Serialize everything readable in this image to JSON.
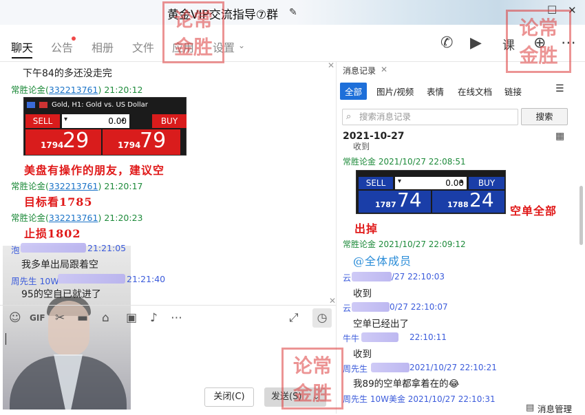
{
  "window": {
    "title": "黄金VIP交流指导⑦群"
  },
  "nav": {
    "tabs": [
      "聊天",
      "公告",
      "相册",
      "文件",
      "应用",
      "设置"
    ]
  },
  "stamps": [
    "论常\n金胜"
  ],
  "chat": {
    "messages": [
      {
        "text": "下午84的多还没走完"
      },
      {
        "sender": "常胜论金(",
        "qq": "332213761",
        "sender_tail": ")",
        "time": "21:20:12"
      },
      {
        "red": "美盘有操作的朋友，建议空"
      },
      {
        "sender": "常胜论金(",
        "qq": "332213761",
        "sender_tail": ")",
        "time": "21:20:17"
      },
      {
        "red": "目标看1785"
      },
      {
        "sender": "常胜论金(",
        "qq": "332213761",
        "sender_tail": ")",
        "time": "21:20:23"
      },
      {
        "red": "止损1802"
      },
      {
        "sender": "泡",
        "time": "21:21:05"
      },
      {
        "text": "我多单出局跟着空"
      },
      {
        "sender": "周先生 10W",
        "time": "21:21:40"
      },
      {
        "text": "95的空自已就进了"
      }
    ],
    "widget": {
      "header": "Gold, H1:  Gold vs. US Dollar",
      "sell": "SELL",
      "buy": "BUY",
      "lots": "0.00",
      "bid_prefix": "1794",
      "bid_big": "29",
      "ask_prefix": "1794",
      "ask_big": "79"
    }
  },
  "input": {
    "close_label": "关闭(C)",
    "send_label": "发送(S)"
  },
  "history": {
    "tab_label": "消息记录",
    "filters": [
      "全部",
      "图片/视频",
      "表情",
      "在线文档",
      "链接"
    ],
    "search_placeholder": "搜索消息记录",
    "search_button": "搜索",
    "date": "2021-10-27",
    "cut_text": "收到",
    "entries": [
      {
        "sender": "常胜论金 2021/10/27 22:08:51"
      },
      {
        "red": "空单全部"
      },
      {
        "red2": "出掉"
      },
      {
        "sender": "常胜论金 2021/10/27 22:09:12"
      },
      {
        "at": "@全体成员"
      },
      {
        "sender": "云",
        "time": "/27 22:10:03"
      },
      {
        "text": "收到"
      },
      {
        "sender": "云",
        "time": "0/27 22:10:07"
      },
      {
        "text": "空单已经出了"
      },
      {
        "sender": "牛牛",
        "time": "22:10:11"
      },
      {
        "text": "收到"
      },
      {
        "sender": "周先生",
        "time": "2021/10/27 22:10:21"
      },
      {
        "text": "我89的空单都拿着在的😂"
      },
      {
        "sender": "周先生 10W美金 2021/10/27 22:10:31"
      }
    ],
    "widget": {
      "sell": "SELL",
      "buy": "BUY",
      "lots": "0.00",
      "bid_prefix": "1787",
      "bid_big": "74",
      "ask_prefix": "1788",
      "ask_big": "24"
    },
    "manage_label": "消息管理"
  }
}
